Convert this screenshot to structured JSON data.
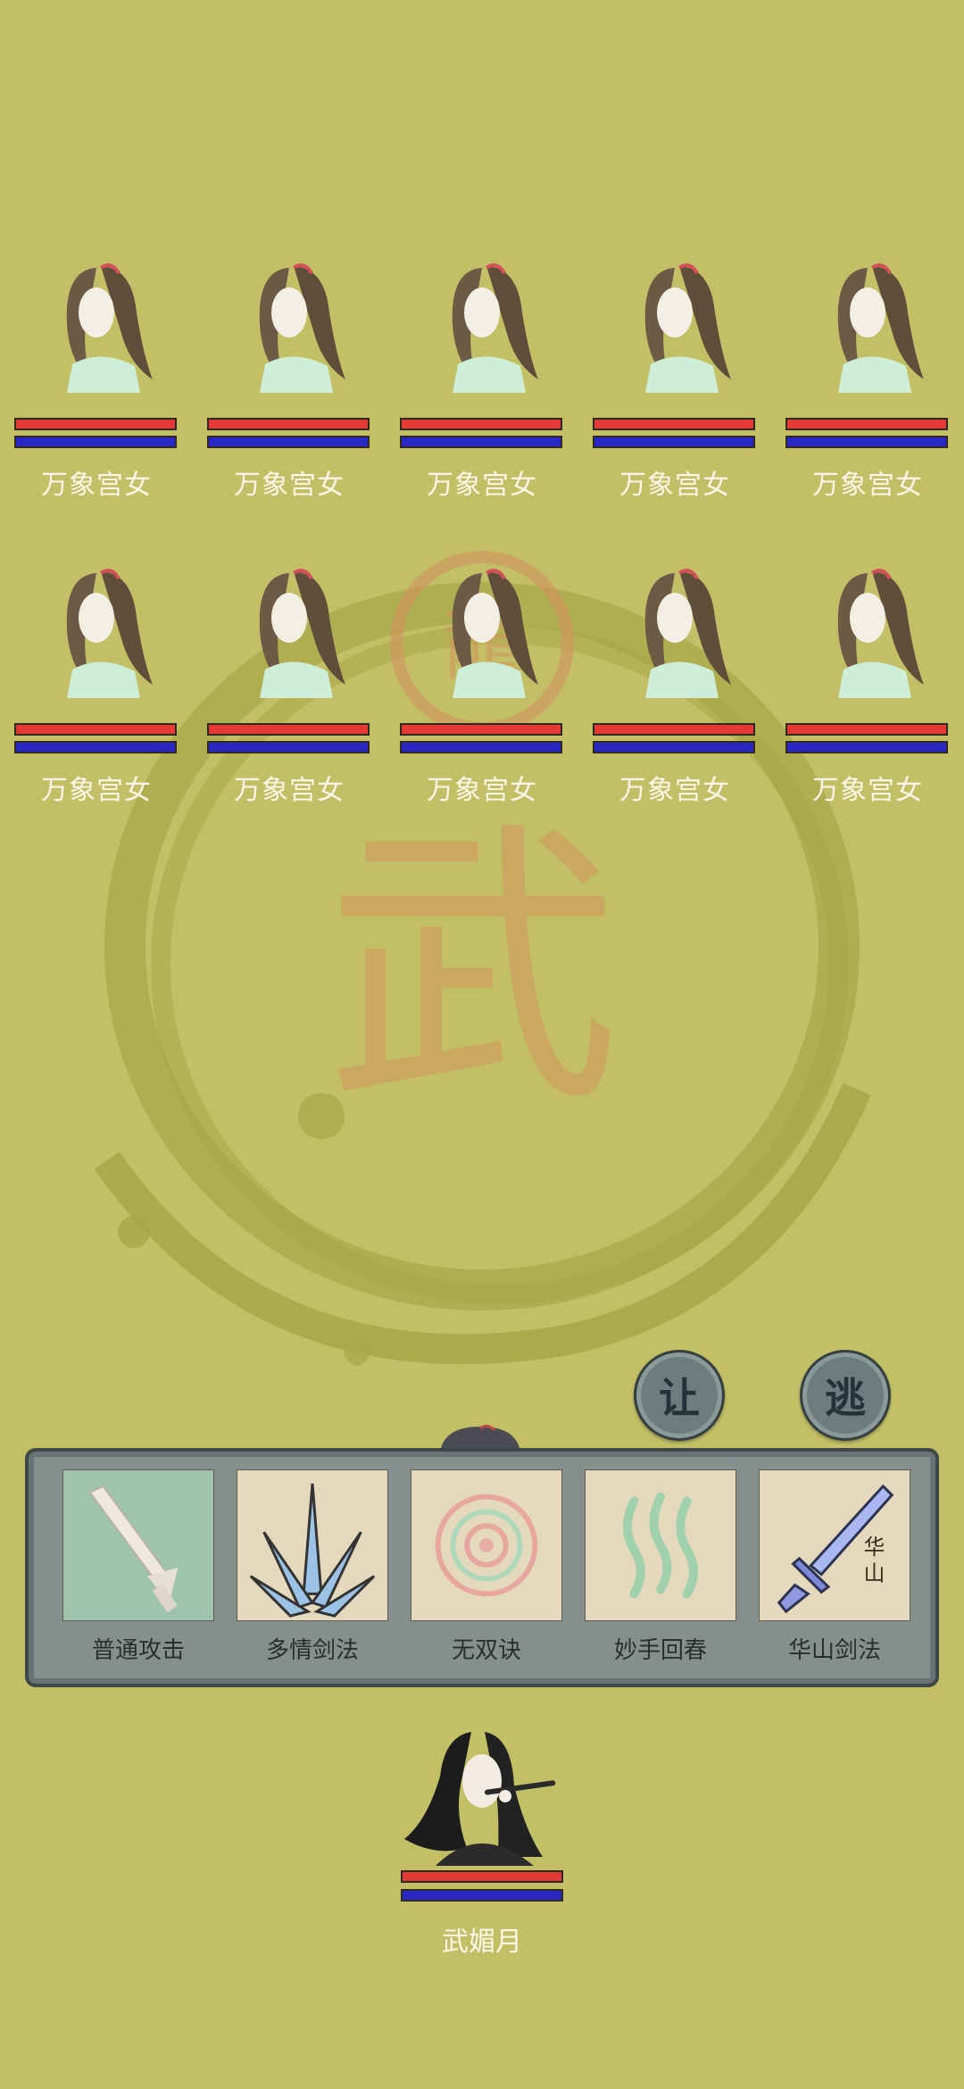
{
  "colors": {
    "background": "#c2bf66",
    "hp": "#e53935",
    "mp": "#2a28c2",
    "name_text": "#fbf7e8"
  },
  "background_emblem": {
    "glyph": "武",
    "seal_glyph": "龍"
  },
  "enemies": [
    {
      "name": "万象宫女",
      "hp": 1.0,
      "mp": 1.0
    },
    {
      "name": "万象宫女",
      "hp": 1.0,
      "mp": 1.0
    },
    {
      "name": "万象宫女",
      "hp": 1.0,
      "mp": 1.0
    },
    {
      "name": "万象宫女",
      "hp": 1.0,
      "mp": 1.0
    },
    {
      "name": "万象宫女",
      "hp": 1.0,
      "mp": 1.0
    },
    {
      "name": "万象宫女",
      "hp": 1.0,
      "mp": 1.0
    },
    {
      "name": "万象宫女",
      "hp": 1.0,
      "mp": 1.0
    },
    {
      "name": "万象宫女",
      "hp": 1.0,
      "mp": 1.0
    },
    {
      "name": "万象宫女",
      "hp": 1.0,
      "mp": 1.0
    },
    {
      "name": "万象宫女",
      "hp": 1.0,
      "mp": 1.0
    }
  ],
  "actions": {
    "yield_label": "让",
    "flee_label": "逃"
  },
  "skills": [
    {
      "label": "普通攻击",
      "icon": "sword-icon"
    },
    {
      "label": "多情剑法",
      "icon": "crystal-blades-icon"
    },
    {
      "label": "无双诀",
      "icon": "spiral-icon"
    },
    {
      "label": "妙手回春",
      "icon": "healing-waves-icon"
    },
    {
      "label": "华山剑法",
      "icon": "huashan-sword-icon",
      "icon_text": "华山"
    }
  ],
  "player": {
    "name": "武媚月",
    "hp": 1.0,
    "mp": 1.0
  }
}
